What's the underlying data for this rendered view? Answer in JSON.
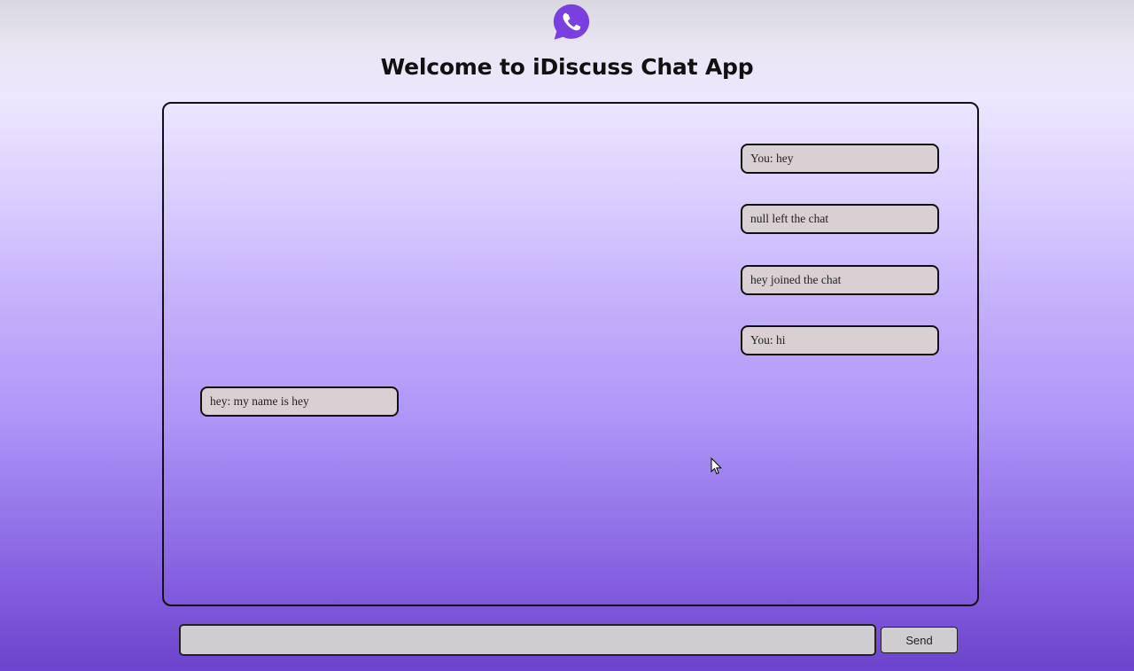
{
  "header": {
    "logo_icon": "whatsapp-phone-icon",
    "logo_color": "#7b3fe0",
    "title": "Welcome to iDiscuss Chat App"
  },
  "chat": {
    "messages": [
      {
        "text": "You: hey",
        "side": "right"
      },
      {
        "text": "null left the chat",
        "side": "right"
      },
      {
        "text": "hey joined the chat",
        "side": "right"
      },
      {
        "text": "You: hi",
        "side": "right"
      },
      {
        "text": "hey: my name is hey",
        "side": "left"
      }
    ]
  },
  "composer": {
    "input_value": "",
    "input_placeholder": "",
    "send_label": "Send"
  },
  "colors": {
    "message_bg": "#d8d0d2",
    "border": "#111111"
  }
}
